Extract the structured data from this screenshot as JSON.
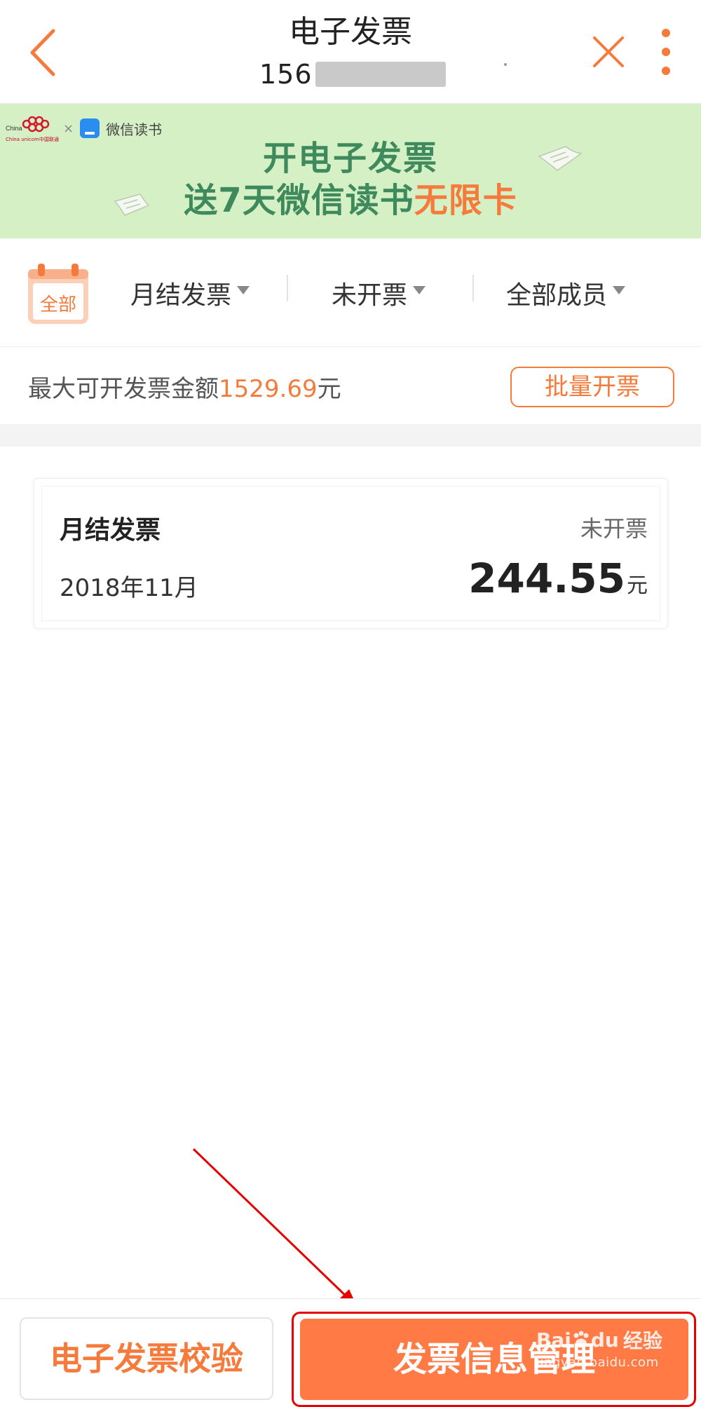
{
  "header": {
    "title": "电子发票",
    "phone_prefix": "156"
  },
  "banner": {
    "brand_unicom": "China unicom中国联通",
    "brand_times": "×",
    "brand_wxread": "微信读书",
    "line1": "开电子发票",
    "line2_prefix": "送7天微信读书",
    "line2_highlight": "无限卡"
  },
  "filters": {
    "calendar_label": "全部",
    "type": "月结发票",
    "status": "未开票",
    "member": "全部成员"
  },
  "amount": {
    "label": "最大可开发票金额",
    "value": "1529.69",
    "unit": "元",
    "batch_button": "批量开票"
  },
  "invoices": [
    {
      "title": "月结发票",
      "status": "未开票",
      "date": "2018年11月",
      "amount": "244.55",
      "unit": "元"
    }
  ],
  "bottom": {
    "verify_button": "电子发票校验",
    "manage_button": "发票信息管理"
  },
  "watermark": {
    "brand": "Bai",
    "brand_suffix": "du",
    "label": "经验",
    "url": "jingyan.baidu.com"
  },
  "colors": {
    "accent": "#f57b3c",
    "primary_button": "#ff7a45",
    "banner_bg": "#d6f0c5",
    "banner_text": "#3f8a5c",
    "annotation": "#e60000"
  }
}
